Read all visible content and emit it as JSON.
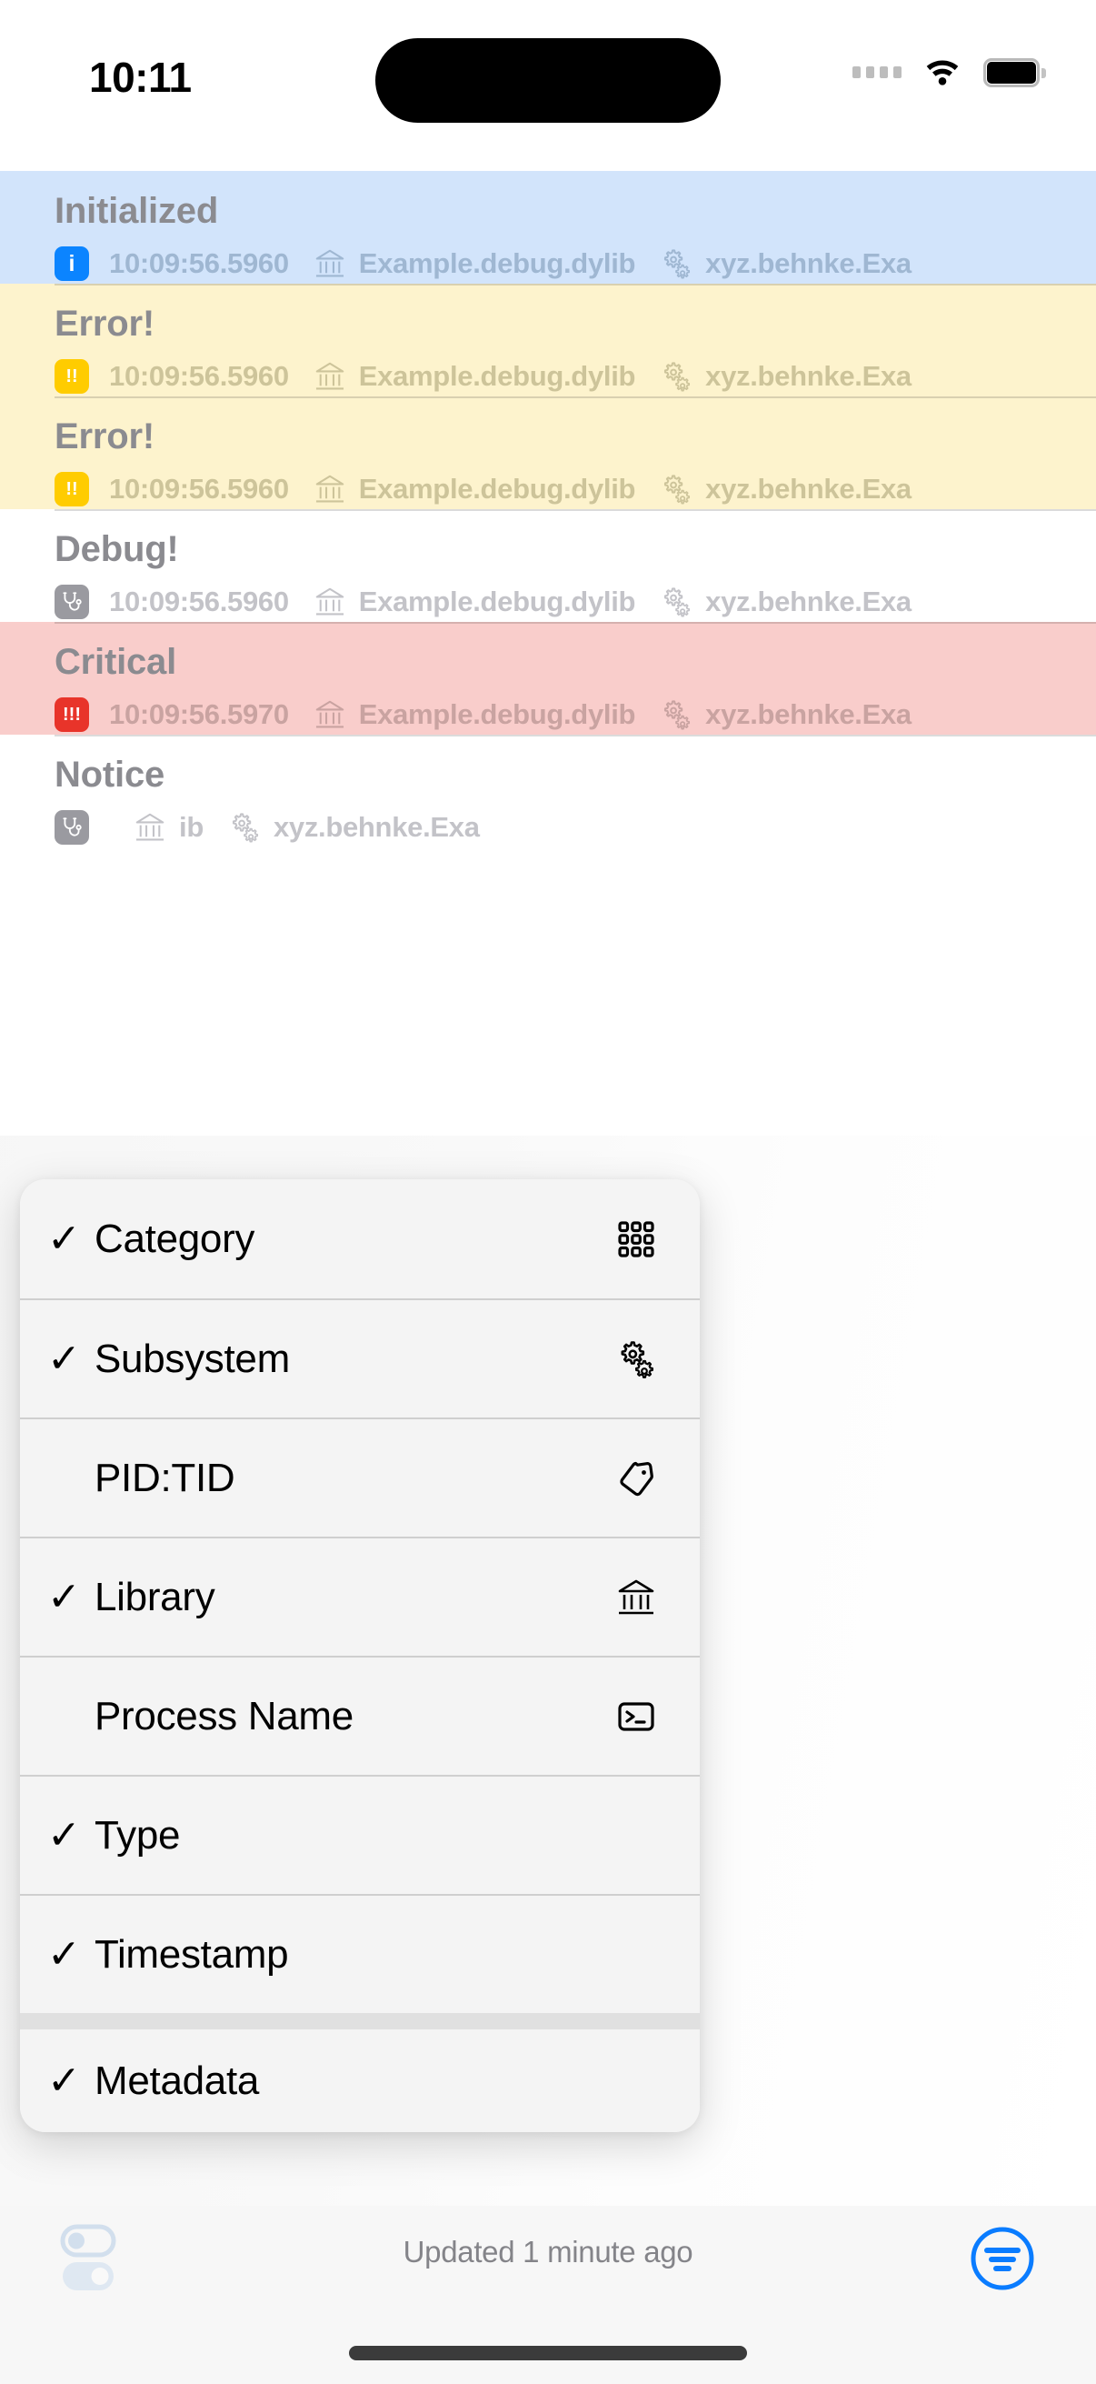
{
  "status_bar": {
    "time": "10:11",
    "icons": [
      "signal-dots-icon",
      "wifi-icon",
      "battery-icon"
    ]
  },
  "log_list": {
    "rows": [
      {
        "title": "Initialized",
        "level": "info",
        "badge_icon": "info-badge-icon",
        "badge_glyph": "i",
        "timestamp": "10:09:56.5960",
        "library_icon": "library-icon",
        "library": "Example.debug.dylib",
        "subsystem_icon": "gears-icon",
        "subsystem": "xyz.behnke.Exa",
        "bg": "#d2e4fb"
      },
      {
        "title": "Error!",
        "level": "error",
        "badge_icon": "warning-badge-icon",
        "badge_glyph": "!!",
        "timestamp": "10:09:56.5960",
        "library_icon": "library-icon",
        "library": "Example.debug.dylib",
        "subsystem_icon": "gears-icon",
        "subsystem": "xyz.behnke.Exa",
        "bg": "#fdf3cd"
      },
      {
        "title": "Error!",
        "level": "error",
        "badge_icon": "warning-badge-icon",
        "badge_glyph": "!!",
        "timestamp": "10:09:56.5960",
        "library_icon": "library-icon",
        "library": "Example.debug.dylib",
        "subsystem_icon": "gears-icon",
        "subsystem": "xyz.behnke.Exa",
        "bg": "#fdf3cd"
      },
      {
        "title": "Debug!",
        "level": "debug",
        "badge_icon": "stethoscope-badge-icon",
        "badge_glyph": "",
        "timestamp": "10:09:56.5960",
        "library_icon": "library-icon",
        "library": "Example.debug.dylib",
        "subsystem_icon": "gears-icon",
        "subsystem": "xyz.behnke.Exa",
        "bg": "#ffffff"
      },
      {
        "title": "Critical",
        "level": "critical",
        "badge_icon": "critical-badge-icon",
        "badge_glyph": "!!!",
        "timestamp": "10:09:56.5970",
        "library_icon": "library-icon",
        "library": "Example.debug.dylib",
        "subsystem_icon": "gears-icon",
        "subsystem": "xyz.behnke.Exa",
        "bg": "#f9cdcb"
      },
      {
        "title": "Notice",
        "level": "notice",
        "badge_icon": "notice-badge-icon",
        "badge_glyph": "",
        "timestamp": "",
        "library_icon": "library-icon",
        "library": "ib",
        "subsystem_icon": "gears-icon",
        "subsystem": "xyz.behnke.Exa",
        "bg": "#ffffff"
      }
    ]
  },
  "context_menu": {
    "items": [
      {
        "label": "Category",
        "checked": true,
        "check": "✓",
        "icon": "grid-3x3-icon",
        "separator_before": false
      },
      {
        "label": "Subsystem",
        "checked": true,
        "check": "✓",
        "icon": "gears-icon",
        "separator_before": false
      },
      {
        "label": "PID:TID",
        "checked": false,
        "check": "",
        "icon": "tag-icon",
        "separator_before": false
      },
      {
        "label": "Library",
        "checked": true,
        "check": "✓",
        "icon": "library-icon",
        "separator_before": false
      },
      {
        "label": "Process Name",
        "checked": false,
        "check": "",
        "icon": "terminal-icon",
        "separator_before": false
      },
      {
        "label": "Type",
        "checked": true,
        "check": "✓",
        "icon": "",
        "separator_before": false
      },
      {
        "label": "Timestamp",
        "checked": true,
        "check": "✓",
        "icon": "",
        "separator_before": false
      },
      {
        "label": "Metadata",
        "checked": true,
        "check": "✓",
        "icon": "",
        "separator_before": true
      }
    ]
  },
  "toolbar": {
    "switches_icon": "switches-icon",
    "updated_text": "Updated 1 minute ago",
    "filter_icon": "filter-circle-icon",
    "filter_color": "#0a7cff"
  }
}
